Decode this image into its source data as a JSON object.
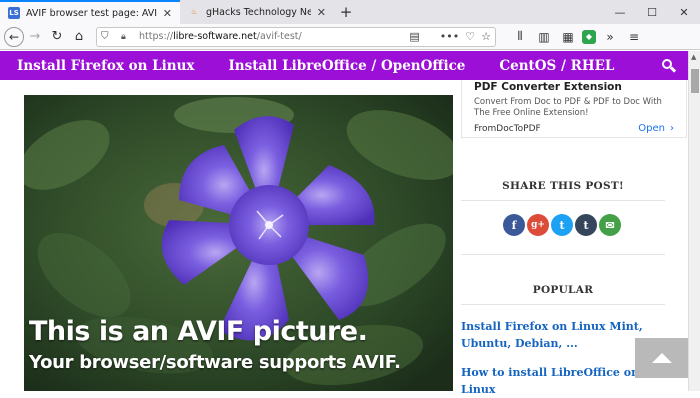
{
  "tabs": [
    {
      "title": "AVIF browser test page: AVIF s",
      "favicon": "LS",
      "active": true
    },
    {
      "title": "gHacks Technology News",
      "favicon": "ghacks-flame-icon",
      "active": false
    }
  ],
  "window_controls": {
    "minimize": "—",
    "maximize": "☐",
    "close": "✕"
  },
  "nav": {
    "back": "←",
    "forward": "→",
    "reload": "↻",
    "home": "⌂",
    "url_scheme": "https://",
    "url_domain": "libre-software.net",
    "url_path": "/avif-test/"
  },
  "site_nav": {
    "items": [
      "Install Firefox on Linux",
      "Install LibreOffice / OpenOffice",
      "CentOS / RHEL"
    ]
  },
  "hero": {
    "caption_line1": "This is an AVIF picture.",
    "caption_line2": "Your browser/software supports AVIF."
  },
  "ad": {
    "title": "PDF Converter Extension",
    "description": "Convert From Doc to PDF & PDF to Doc With The Free Online Extension!",
    "source": "FromDocToPDF",
    "open_label": "Open",
    "open_arrow": "›"
  },
  "share": {
    "heading": "SHARE THIS POST!",
    "buttons": [
      {
        "name": "facebook",
        "glyph": "f",
        "color": "#3b5998"
      },
      {
        "name": "google-plus",
        "glyph": "g+",
        "color": "#dd4b39"
      },
      {
        "name": "twitter",
        "glyph": "t",
        "color": "#1da1f2"
      },
      {
        "name": "tumblr",
        "glyph": "t",
        "color": "#35465c"
      },
      {
        "name": "email",
        "glyph": "✉",
        "color": "#43a047"
      }
    ]
  },
  "popular": {
    "heading": "POPULAR",
    "links": [
      "Install Firefox on Linux Mint, Ubuntu, Debian, ...",
      "How to install LibreOffice on Linux"
    ]
  },
  "colors": {
    "site_nav_bg": "#9c0fd6",
    "link": "#1565c0",
    "tab_accent": "#0a84ff"
  }
}
